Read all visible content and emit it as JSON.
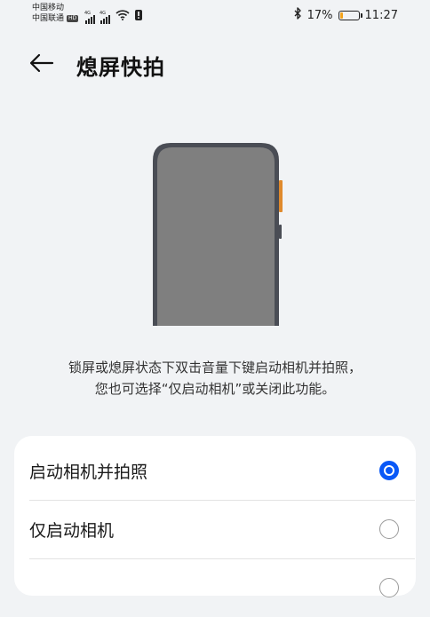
{
  "status_bar": {
    "carrier1": "中国移动",
    "carrier2": "中国联通",
    "hd_badge": "HD",
    "sim1_tag": "4G",
    "sim2_tag": "4G",
    "battery_percent": "17%",
    "battery_level": 0.17,
    "time": "11:27",
    "icons": [
      "signal-icon",
      "signal-icon",
      "wifi-icon",
      "alert-icon",
      "bluetooth-icon",
      "battery-icon"
    ]
  },
  "header": {
    "back_icon": "back-arrow-icon",
    "title": "熄屏快拍"
  },
  "description": {
    "line1": "锁屏或熄屏状态下双击音量下键启动相机并拍照，",
    "line2": "您也可选择“仅启动相机”或关闭此功能。"
  },
  "options": [
    {
      "label": "启动相机并拍照",
      "selected": true
    },
    {
      "label": "仅启动相机",
      "selected": false
    },
    {
      "label": "",
      "selected": false
    }
  ],
  "colors": {
    "accent": "#0a59f7",
    "background": "#f1f3f5",
    "phone_screen": "#7f7f7f",
    "phone_frame": "#4a4d55",
    "volume_key": "#e08a2c"
  }
}
